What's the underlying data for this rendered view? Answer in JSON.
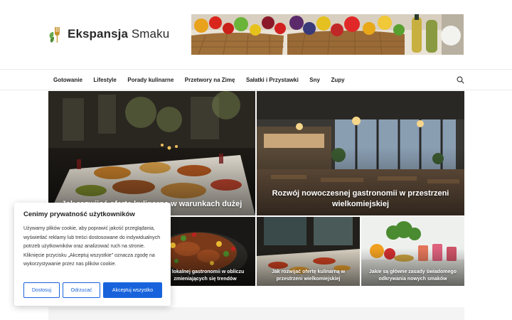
{
  "site": {
    "name_bold": "Ekspansja",
    "name_light": "Smaku"
  },
  "nav": {
    "items": [
      "Gotowanie",
      "Lifestyle",
      "Porady kulinarne",
      "Przetwory na Zimę",
      "Sałatki i Przystawki",
      "Sny",
      "Zupy"
    ],
    "search_icon": "search-icon"
  },
  "featured": [
    {
      "title": "Jak rozwijać ofertę kulinarną w warunkach dużej"
    },
    {
      "title": "Rozwój nowoczesnej gastronomii w przestrzeni wielkomiejskiej"
    }
  ],
  "grid": [
    {
      "title": "ój lokalnej gastronomii w obliczu zmieniających się trendów"
    },
    {
      "title": "Jak rozwijać ofertę kulinarną w przestrzeni wielkomiejskiej"
    },
    {
      "title": "Jakie są główne zasady świadomego odkrywania nowych smaków"
    }
  ],
  "cookie": {
    "title": "Cenimy prywatność użytkowników",
    "text": "Używamy plików cookie, aby poprawić jakość przeglądania, wyświetlać reklamy lub treści dostosowane do indywidualnych potrzeb użytkowników oraz analizować ruch na stronie. Kliknięcie przycisku „Akceptuj wszystkie” oznacza zgodę na wykorzystywanie przez nas plików cookie.",
    "customize_label": "Dostosuj",
    "reject_label": "Odrzucać",
    "accept_label": "Akceptuj wszystko"
  },
  "colors": {
    "accent": "#1863dc",
    "text": "#222222"
  }
}
